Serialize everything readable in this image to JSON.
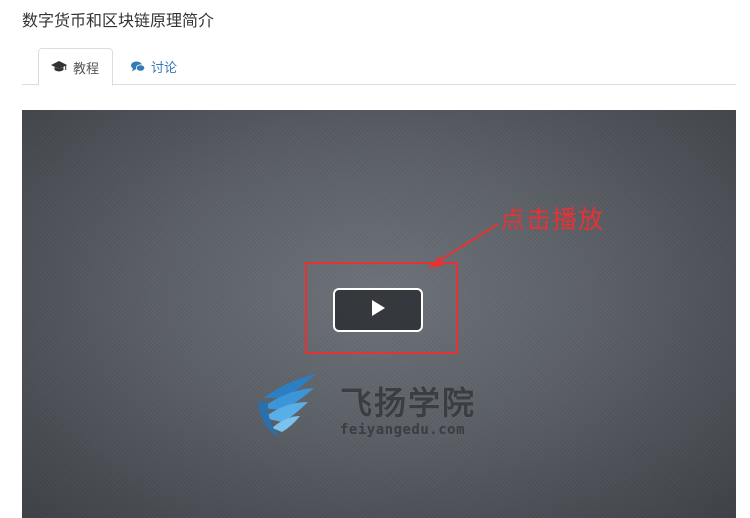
{
  "page": {
    "title": "数字货币和区块链原理简介"
  },
  "tabs": [
    {
      "label": "教程",
      "icon": "graduation-cap-icon",
      "active": true
    },
    {
      "label": "讨论",
      "icon": "comments-icon",
      "active": false
    }
  ],
  "video": {
    "annotation": "点击播放",
    "annotation_color": "#e53333",
    "play_icon": "play-icon",
    "logo": {
      "name": "飞扬学院",
      "url": "feiyangedu.com",
      "icon": "wing-logo-icon"
    }
  },
  "colors": {
    "link": "#337ab7",
    "border": "#dddddd"
  }
}
